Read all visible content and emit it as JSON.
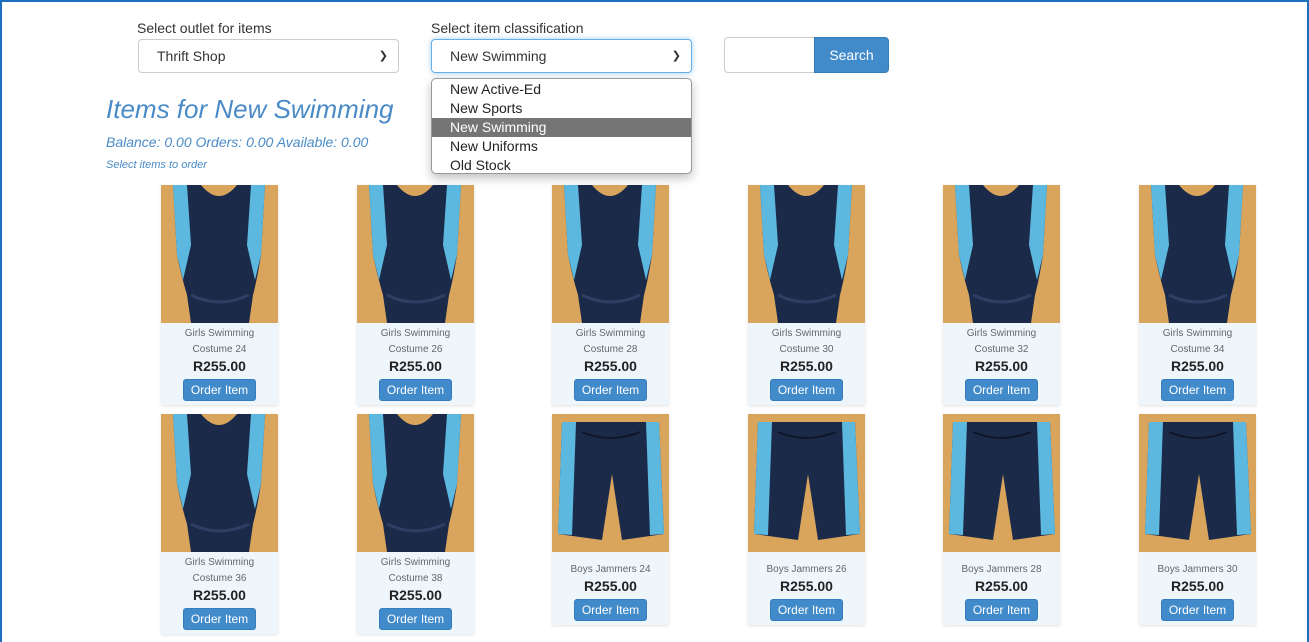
{
  "outlet": {
    "label": "Select outlet for items",
    "selected": "Thrift Shop"
  },
  "classification": {
    "label": "Select item classification",
    "selected": "New Swimming",
    "options": [
      "New Active-Ed",
      "New Sports",
      "New Swimming",
      "New Uniforms",
      "Old Stock"
    ],
    "selected_index": 2
  },
  "search": {
    "placeholder": "",
    "button_label": "Search"
  },
  "heading": "Items for New Swimming",
  "balance_line": "Balance: 0.00 Orders: 0.00 Available: 0.00",
  "hint": "Select items to order",
  "order_label": "Order Item",
  "colors": {
    "accent": "#428bca",
    "heading": "#4a8bc7",
    "card_bg": "#eef6fc",
    "photo_bg": "#d9a55d"
  },
  "items": [
    {
      "name1": "Girls Swimming",
      "name2": "Costume 24",
      "price": "R255.00",
      "kind": "costume"
    },
    {
      "name1": "Girls Swimming",
      "name2": "Costume 26",
      "price": "R255.00",
      "kind": "costume"
    },
    {
      "name1": "Girls Swimming",
      "name2": "Costume 28",
      "price": "R255.00",
      "kind": "costume"
    },
    {
      "name1": "Girls Swimming",
      "name2": "Costume 30",
      "price": "R255.00",
      "kind": "costume"
    },
    {
      "name1": "Girls Swimming",
      "name2": "Costume 32",
      "price": "R255.00",
      "kind": "costume"
    },
    {
      "name1": "Girls Swimming",
      "name2": "Costume 34",
      "price": "R255.00",
      "kind": "costume"
    },
    {
      "name1": "Girls Swimming",
      "name2": "Costume 36",
      "price": "R255.00",
      "kind": "costume"
    },
    {
      "name1": "Girls Swimming",
      "name2": "Costume 38",
      "price": "R255.00",
      "kind": "costume"
    },
    {
      "name1": "Boys Jammers 24",
      "name2": "",
      "price": "R255.00",
      "kind": "jammers"
    },
    {
      "name1": "Boys Jammers 26",
      "name2": "",
      "price": "R255.00",
      "kind": "jammers"
    },
    {
      "name1": "Boys Jammers 28",
      "name2": "",
      "price": "R255.00",
      "kind": "jammers"
    },
    {
      "name1": "Boys Jammers 30",
      "name2": "",
      "price": "R255.00",
      "kind": "jammers"
    }
  ]
}
